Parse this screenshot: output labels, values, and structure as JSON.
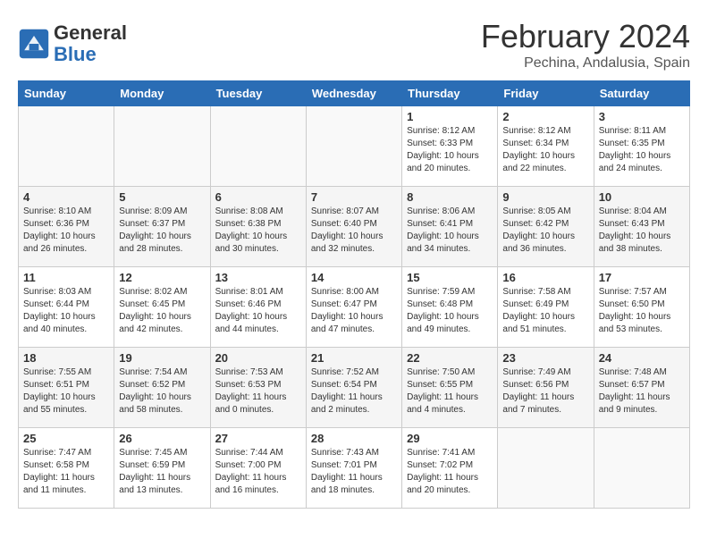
{
  "header": {
    "title": "February 2024",
    "subtitle": "Pechina, Andalusia, Spain",
    "logo_general": "General",
    "logo_blue": "Blue"
  },
  "days_of_week": [
    "Sunday",
    "Monday",
    "Tuesday",
    "Wednesday",
    "Thursday",
    "Friday",
    "Saturday"
  ],
  "weeks": [
    [
      {
        "day": "",
        "info": ""
      },
      {
        "day": "",
        "info": ""
      },
      {
        "day": "",
        "info": ""
      },
      {
        "day": "",
        "info": ""
      },
      {
        "day": "1",
        "info": "Sunrise: 8:12 AM\nSunset: 6:33 PM\nDaylight: 10 hours\nand 20 minutes."
      },
      {
        "day": "2",
        "info": "Sunrise: 8:12 AM\nSunset: 6:34 PM\nDaylight: 10 hours\nand 22 minutes."
      },
      {
        "day": "3",
        "info": "Sunrise: 8:11 AM\nSunset: 6:35 PM\nDaylight: 10 hours\nand 24 minutes."
      }
    ],
    [
      {
        "day": "4",
        "info": "Sunrise: 8:10 AM\nSunset: 6:36 PM\nDaylight: 10 hours\nand 26 minutes."
      },
      {
        "day": "5",
        "info": "Sunrise: 8:09 AM\nSunset: 6:37 PM\nDaylight: 10 hours\nand 28 minutes."
      },
      {
        "day": "6",
        "info": "Sunrise: 8:08 AM\nSunset: 6:38 PM\nDaylight: 10 hours\nand 30 minutes."
      },
      {
        "day": "7",
        "info": "Sunrise: 8:07 AM\nSunset: 6:40 PM\nDaylight: 10 hours\nand 32 minutes."
      },
      {
        "day": "8",
        "info": "Sunrise: 8:06 AM\nSunset: 6:41 PM\nDaylight: 10 hours\nand 34 minutes."
      },
      {
        "day": "9",
        "info": "Sunrise: 8:05 AM\nSunset: 6:42 PM\nDaylight: 10 hours\nand 36 minutes."
      },
      {
        "day": "10",
        "info": "Sunrise: 8:04 AM\nSunset: 6:43 PM\nDaylight: 10 hours\nand 38 minutes."
      }
    ],
    [
      {
        "day": "11",
        "info": "Sunrise: 8:03 AM\nSunset: 6:44 PM\nDaylight: 10 hours\nand 40 minutes."
      },
      {
        "day": "12",
        "info": "Sunrise: 8:02 AM\nSunset: 6:45 PM\nDaylight: 10 hours\nand 42 minutes."
      },
      {
        "day": "13",
        "info": "Sunrise: 8:01 AM\nSunset: 6:46 PM\nDaylight: 10 hours\nand 44 minutes."
      },
      {
        "day": "14",
        "info": "Sunrise: 8:00 AM\nSunset: 6:47 PM\nDaylight: 10 hours\nand 47 minutes."
      },
      {
        "day": "15",
        "info": "Sunrise: 7:59 AM\nSunset: 6:48 PM\nDaylight: 10 hours\nand 49 minutes."
      },
      {
        "day": "16",
        "info": "Sunrise: 7:58 AM\nSunset: 6:49 PM\nDaylight: 10 hours\nand 51 minutes."
      },
      {
        "day": "17",
        "info": "Sunrise: 7:57 AM\nSunset: 6:50 PM\nDaylight: 10 hours\nand 53 minutes."
      }
    ],
    [
      {
        "day": "18",
        "info": "Sunrise: 7:55 AM\nSunset: 6:51 PM\nDaylight: 10 hours\nand 55 minutes."
      },
      {
        "day": "19",
        "info": "Sunrise: 7:54 AM\nSunset: 6:52 PM\nDaylight: 10 hours\nand 58 minutes."
      },
      {
        "day": "20",
        "info": "Sunrise: 7:53 AM\nSunset: 6:53 PM\nDaylight: 11 hours\nand 0 minutes."
      },
      {
        "day": "21",
        "info": "Sunrise: 7:52 AM\nSunset: 6:54 PM\nDaylight: 11 hours\nand 2 minutes."
      },
      {
        "day": "22",
        "info": "Sunrise: 7:50 AM\nSunset: 6:55 PM\nDaylight: 11 hours\nand 4 minutes."
      },
      {
        "day": "23",
        "info": "Sunrise: 7:49 AM\nSunset: 6:56 PM\nDaylight: 11 hours\nand 7 minutes."
      },
      {
        "day": "24",
        "info": "Sunrise: 7:48 AM\nSunset: 6:57 PM\nDaylight: 11 hours\nand 9 minutes."
      }
    ],
    [
      {
        "day": "25",
        "info": "Sunrise: 7:47 AM\nSunset: 6:58 PM\nDaylight: 11 hours\nand 11 minutes."
      },
      {
        "day": "26",
        "info": "Sunrise: 7:45 AM\nSunset: 6:59 PM\nDaylight: 11 hours\nand 13 minutes."
      },
      {
        "day": "27",
        "info": "Sunrise: 7:44 AM\nSunset: 7:00 PM\nDaylight: 11 hours\nand 16 minutes."
      },
      {
        "day": "28",
        "info": "Sunrise: 7:43 AM\nSunset: 7:01 PM\nDaylight: 11 hours\nand 18 minutes."
      },
      {
        "day": "29",
        "info": "Sunrise: 7:41 AM\nSunset: 7:02 PM\nDaylight: 11 hours\nand 20 minutes."
      },
      {
        "day": "",
        "info": ""
      },
      {
        "day": "",
        "info": ""
      }
    ]
  ]
}
